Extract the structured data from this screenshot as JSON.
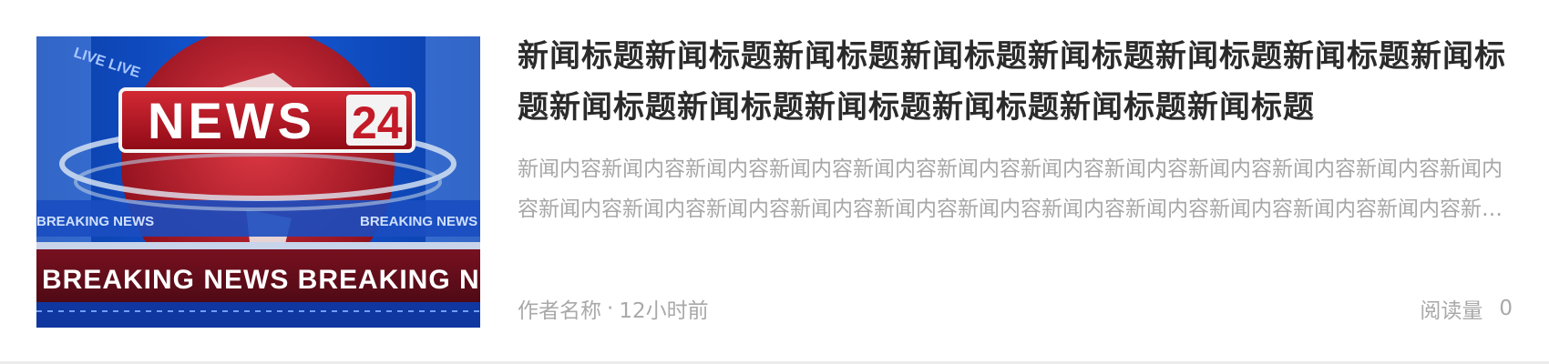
{
  "article": {
    "title": "新闻标题新闻标题新闻标题新闻标题新闻标题新闻标题新闻标题新闻标题新闻标题新闻标题新闻标题新闻标题新闻标题新闻标题",
    "summary": "新闻内容新闻内容新闻内容新闻内容新闻内容新闻内容新闻内容新闻内容新闻内容新闻内容新闻内容新闻内容新闻内容新闻内容新闻内容新闻内容新闻内容新闻内容新闻内容新闻内容新闻内容新闻内容新闻内容新闻内容",
    "author": "作者名称",
    "separator": "·",
    "time": "12小时前",
    "reads_label": "阅读量",
    "reads_count": "0"
  },
  "thumbnail": {
    "logo_word": "NEWS",
    "logo_number": "24",
    "live_text": "LIVE LIVE",
    "band_text": "BREAKING NEWS",
    "ticker_text": "BREAKING NEWS   BREAKING NEWS"
  }
}
